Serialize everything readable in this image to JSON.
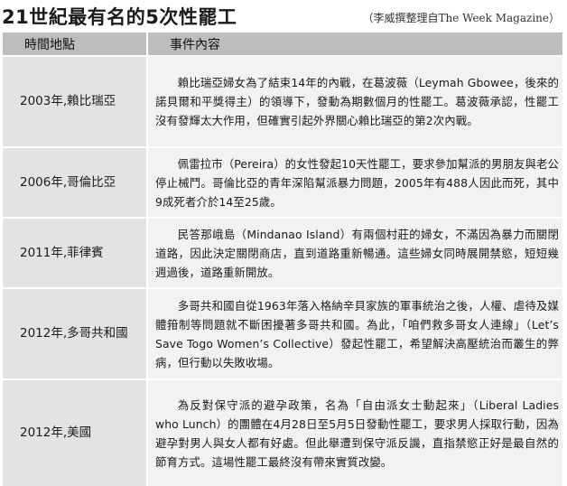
{
  "header": {
    "title": "21世紀最有名的5次性罷工",
    "source": "（李威撰整理自The Week Magazine）"
  },
  "table": {
    "columns": [
      "時間地點",
      "事件內容"
    ],
    "rows": [
      {
        "time": "2003年,賴比瑞亞",
        "event": "賴比瑞亞婦女為了結束14年的內戰，在葛波薇（Leymah Gbowee，後來的諾貝爾和平獎得主）的領導下，發動為期數個月的性罷工。葛波薇承認，性罷工沒有發輝太大作用，但確實引起外界關心賴比瑞亞的第2次內戰。"
      },
      {
        "time": "2006年,哥倫比亞",
        "event": "佩雷拉市（Pereira）的女性發起10天性罷工，要求參加幫派的男朋友與老公停止械鬥。哥倫比亞的青年深陷幫派暴力問題，2005年有488人因此而死，其中9成死者介於14至25歲。"
      },
      {
        "time": "2011年,菲律賓",
        "event": "民答那峨島（Mindanao Island）有兩個村莊的婦女，不滿因為暴力而關閉道路，因此決定關閉商店，直到道路重新暢通。這些婦女同時展開禁慾，短短幾週過後，道路重新開放。"
      },
      {
        "time": "2012年,多哥共和國",
        "event": "多哥共和國自從1963年落入格納辛貝家族的軍事統治之後，人權、虐待及媒體箝制等問題就不斷困擾著多哥共和國。為此，「咱們救多哥女人連線」（Let’s Save Togo Women’s Collective）發起性罷工，希望解決高壓統治而叢生的弊病，但行動以失敗收場。"
      },
      {
        "time": "2012年,美國",
        "event": "為反對保守派的避孕政策，名為「自由派女士動起來」（Liberal Ladies who Lunch）的團體在4月28日至5月5日發動性罷工，要求男人採取行動，因為避孕對男人與女人都有好處。但此舉遭到保守派反譏，直指禁慾正好是最自然的節育方式。這場性罷工最終沒有帶來實質改變。"
      }
    ]
  }
}
